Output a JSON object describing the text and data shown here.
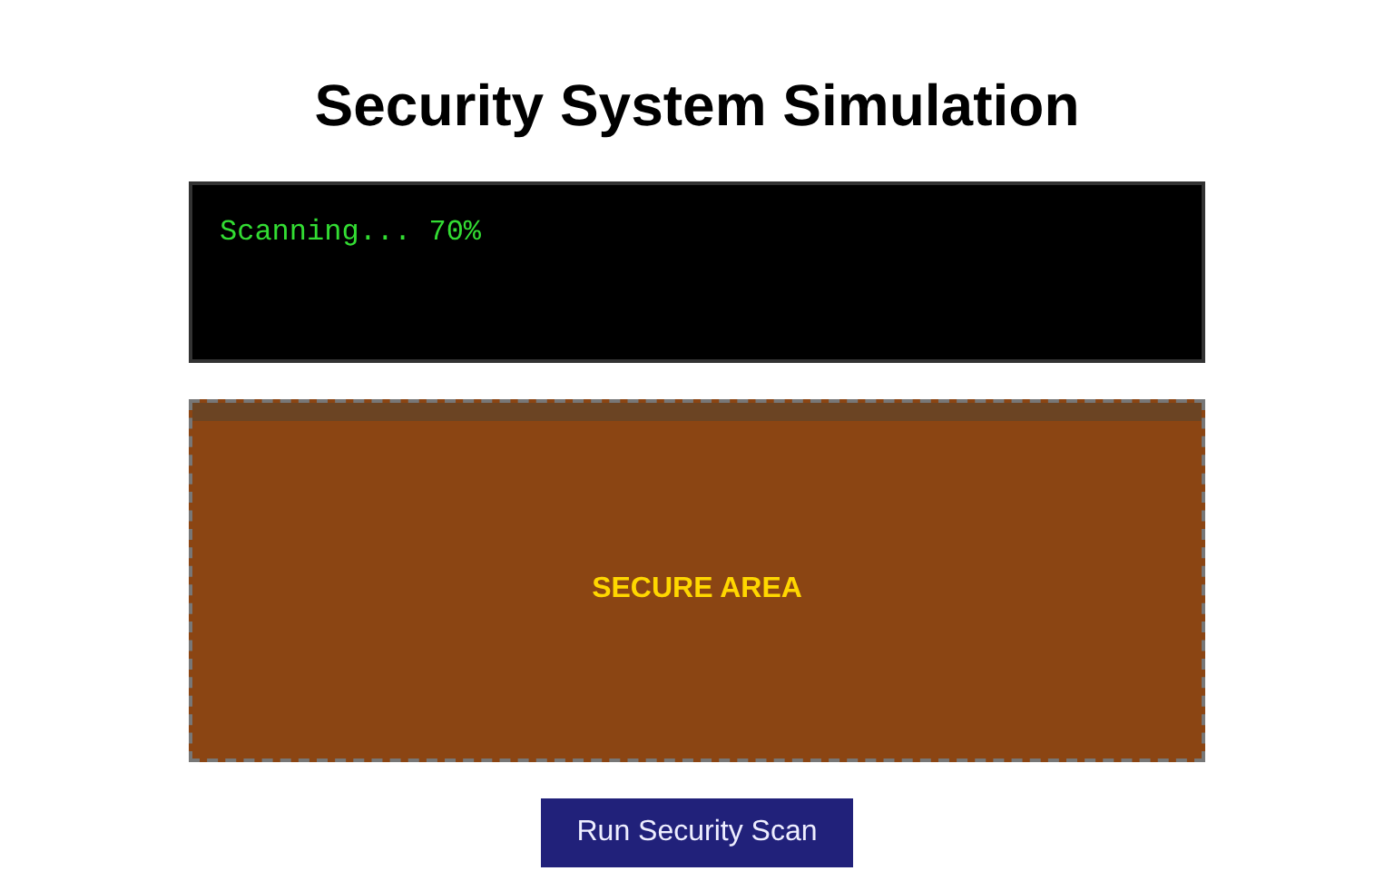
{
  "title": "Security System Simulation",
  "terminal": {
    "text": "Scanning... 70%"
  },
  "secure_area": {
    "label": "SECURE AREA"
  },
  "buttons": [
    "Run Security Scan"
  ]
}
